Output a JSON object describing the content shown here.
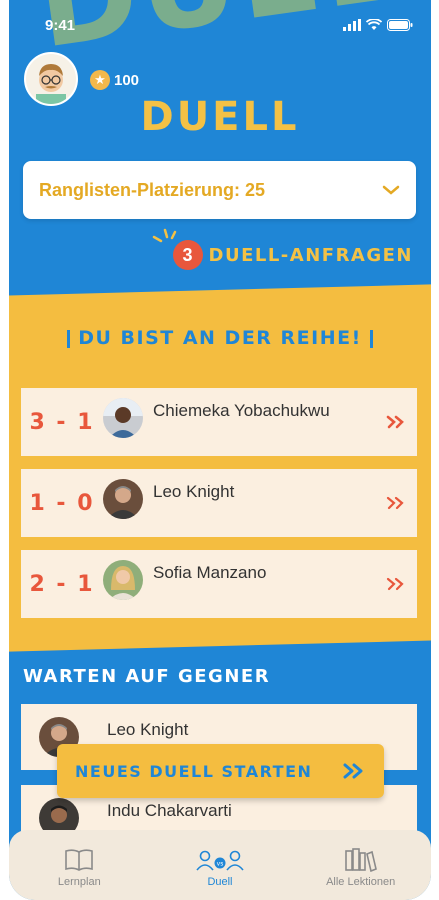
{
  "status_bar": {
    "time": "9:41"
  },
  "background_text": "DUELL",
  "user": {
    "coins": "100"
  },
  "title": "DUELL",
  "ranking": {
    "label": "Ranglisten-Platzierung: 25"
  },
  "requests": {
    "count": "3",
    "label": "DUELL-ANFRAGEN"
  },
  "turn_section": {
    "title": "DU BIST AN DER REIHE!",
    "duels": [
      {
        "score": "3 - 1",
        "name": "Chiemeka Yobachukwu",
        "avatar": "avatar-1"
      },
      {
        "score": "1 - 0",
        "name": "Leo Knight",
        "avatar": "avatar-2"
      },
      {
        "score": "2 - 1",
        "name": "Sofia Manzano",
        "avatar": "avatar-3"
      }
    ]
  },
  "waiting_section": {
    "title": "WARTEN AUF GEGNER",
    "items": [
      {
        "name": "Leo Knight",
        "avatar": "avatar-2"
      },
      {
        "name": "Indu Chakarvarti",
        "avatar": "avatar-4"
      }
    ]
  },
  "cta": {
    "label": "NEUES DUELL STARTEN",
    "icon": "double-chevron-right-icon"
  },
  "tabs": [
    {
      "label": "Lernplan",
      "icon": "book-icon",
      "active": false
    },
    {
      "label": "Duell",
      "icon": "versus-icon",
      "active": true
    },
    {
      "label": "Alle Lektionen",
      "icon": "library-icon",
      "active": false
    }
  ],
  "colors": {
    "primary_blue": "#1f86d6",
    "accent_yellow": "#f4bd40",
    "score_red": "#e8573c",
    "card_bg": "#fbefe0"
  }
}
